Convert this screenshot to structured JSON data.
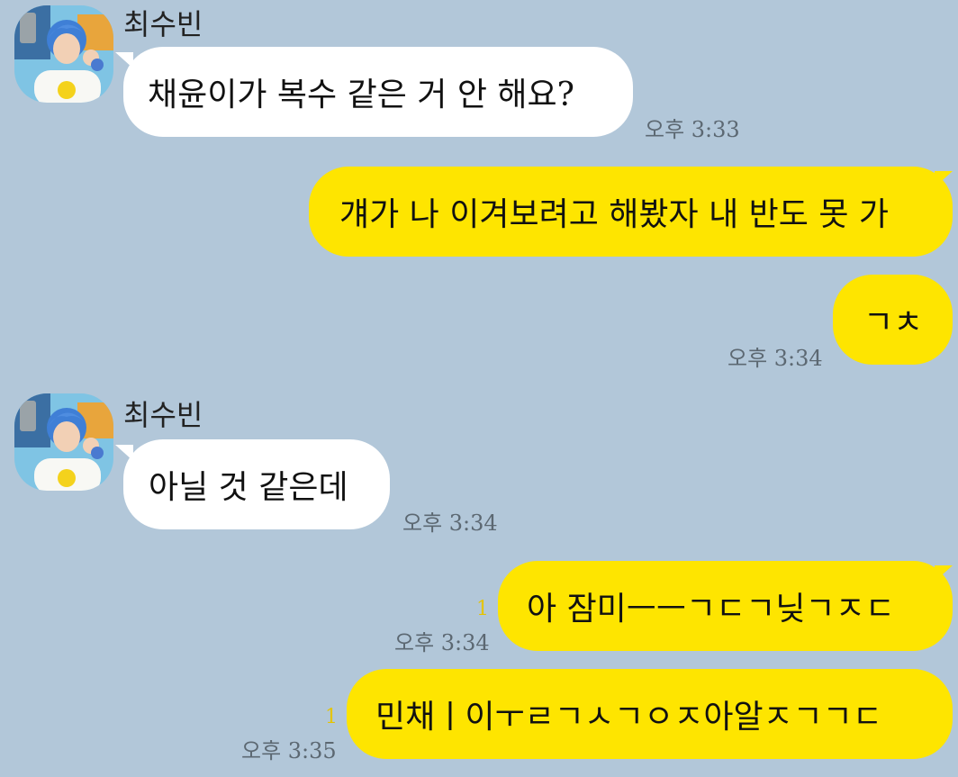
{
  "colors": {
    "background": "#b2c7d9",
    "incoming_bubble": "#ffffff",
    "outgoing_bubble": "#fee500",
    "unread_count": "#e4c400"
  },
  "messages": [
    {
      "sender": "최수빈",
      "text": "채윤이가 복수 같은 거 안 해요?",
      "time": "오후 3:33"
    },
    {
      "text": "걔가 나 이겨보려고 해봤자 내 반도 못 가"
    },
    {
      "text": "ㄱㅊ",
      "time": "오후 3:34"
    },
    {
      "sender": "최수빈",
      "text": "아닐 것 같은데",
      "time": "오후 3:34"
    },
    {
      "text": "아 잠미ㅡㅡㄱㄷㄱ닞ㄱㅈㄷ",
      "time": "오후 3:34",
      "unread": "1"
    },
    {
      "text": "민채ㅣ이ㅜㄹㄱㅅㄱㅇㅈ아알ㅈㄱㄱㄷ",
      "time": "오후 3:35",
      "unread": "1"
    }
  ]
}
